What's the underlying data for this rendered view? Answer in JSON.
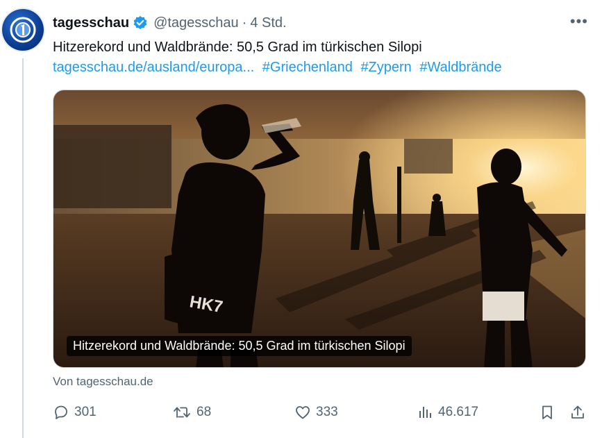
{
  "tweet": {
    "author_name": "tagesschau",
    "author_handle": "@tagesschau",
    "separator": "·",
    "time": "4 Std.",
    "more_label": "•••",
    "text": "Hitzerekord und Waldbrände: 50,5 Grad im türkischen Silopi",
    "link": "tagesschau.de/ausland/europa...",
    "hashtags": [
      "#Griechenland",
      "#Zypern",
      "#Waldbrände"
    ],
    "card_caption": "Hitzerekord und Waldbrände: 50,5 Grad im türkischen Silopi",
    "source": "Von tagesschau.de"
  },
  "actions": {
    "replies": "301",
    "retweets": "68",
    "likes": "333",
    "views": "46.617"
  },
  "colors": {
    "link": "#1d9bf0",
    "verified": "#1d9bf0",
    "muted": "#536471"
  }
}
